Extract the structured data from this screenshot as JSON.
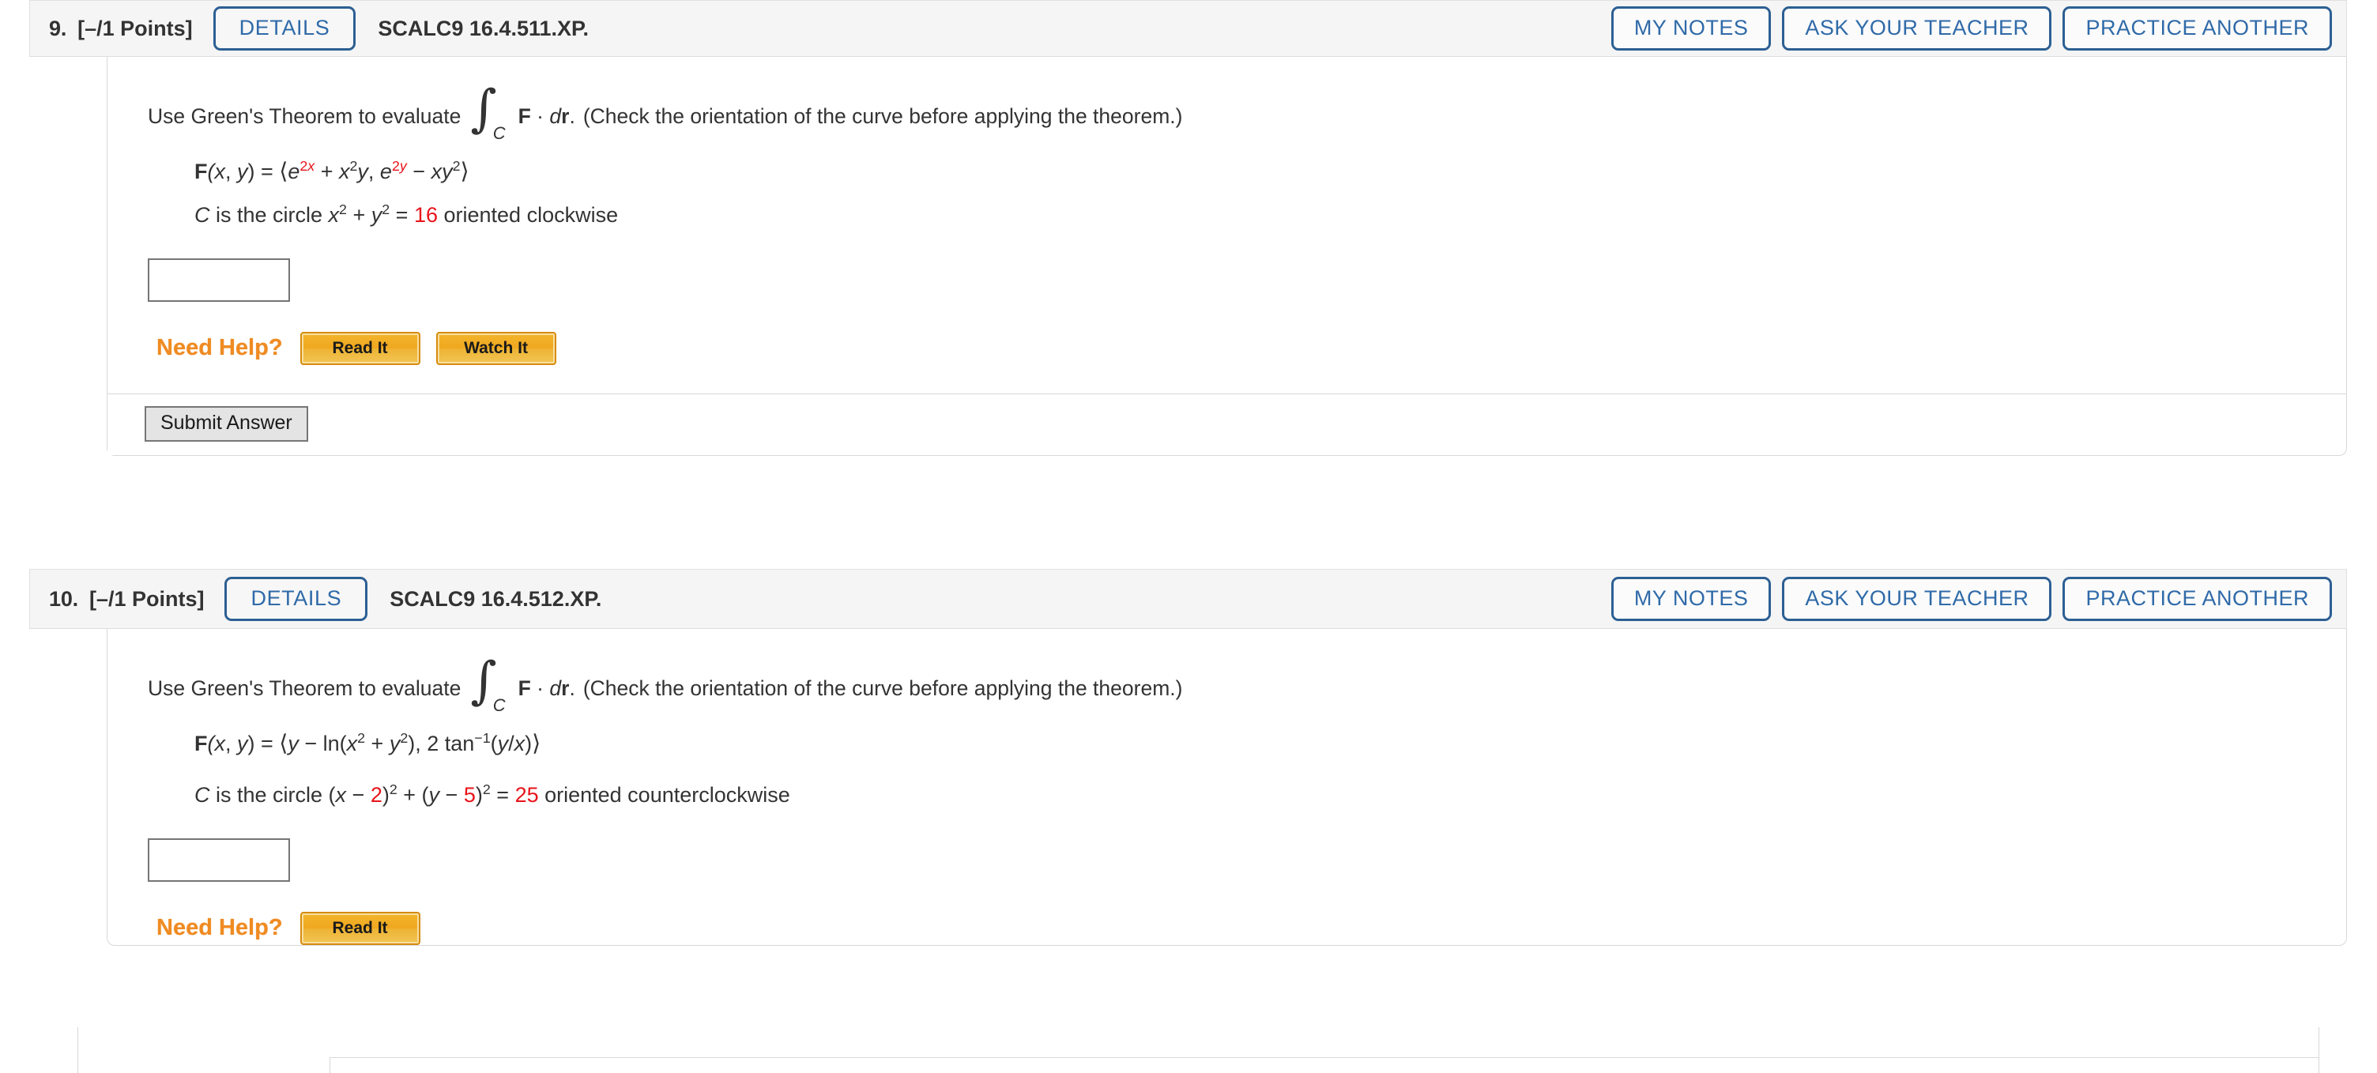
{
  "problems": [
    {
      "number": "9.",
      "points": "[–/1 Points]",
      "details_label": "DETAILS",
      "code": "SCALC9 16.4.511.XP.",
      "my_notes_label": "MY NOTES",
      "ask_teacher_label": "ASK YOUR TEACHER",
      "practice_another_label": "PRACTICE ANOTHER",
      "prompt_before": "Use Green's Theorem to evaluate",
      "integral_subscript": "C",
      "integrand": "F · dr.",
      "prompt_after": "(Check the orientation of the curve before applying the theorem.)",
      "field_line": "F(x, y) = ⟨e2x + x2y, e2y − xy2⟩",
      "curve_line": "C is the circle x2 + y2 = 16 oriented clockwise",
      "field_parts": {
        "lhs": "F",
        "args": "(x, y) = ",
        "open": "⟨",
        "e1_base": "e",
        "e1_exp": "2x",
        "e1_rest_a": " + ",
        "e1_x": "x",
        "e1_x_exp": "2",
        "e1_y": "y",
        "comma": ", ",
        "e2_base": "e",
        "e2_exp": "2y",
        "e2_minus": " − ",
        "e2_xy": "xy",
        "e2_exp2": "2",
        "close": "⟩"
      },
      "curve_parts": {
        "c": "C",
        "is_the_circle": " is the circle ",
        "x": "x",
        "x_exp": "2",
        "plus": " + ",
        "y": "y",
        "y_exp": "2",
        "equals": " = ",
        "radius_sq": "16",
        "orientation": " oriented clockwise"
      },
      "answer_value": "",
      "answer_placeholder": "",
      "need_help_label": "Need Help?",
      "help_buttons": [
        "Read It",
        "Watch It"
      ],
      "submit_label": "Submit Answer",
      "has_submit": true
    },
    {
      "number": "10.",
      "points": "[–/1 Points]",
      "details_label": "DETAILS",
      "code": "SCALC9 16.4.512.XP.",
      "my_notes_label": "MY NOTES",
      "ask_teacher_label": "ASK YOUR TEACHER",
      "practice_another_label": "PRACTICE ANOTHER",
      "prompt_before": "Use Green's Theorem to evaluate",
      "integral_subscript": "C",
      "integrand": "F · dr.",
      "prompt_after": "(Check the orientation of the curve before applying the theorem.)",
      "field_line": "F(x, y) = ⟨y − ln(x2 + y2), 2 tan−1(y/x)⟩",
      "curve_line": "C is the circle (x − 2)2 + (y − 5)2 = 25 oriented counterclockwise",
      "field_parts2": {
        "lhs": "F",
        "args": "(x, y) = ",
        "open": "⟨",
        "y": "y",
        "minus": " − ",
        "ln": "ln(",
        "x": "x",
        "x_exp": "2",
        "plus": " + ",
        "y2": "y",
        "y2_exp": "2",
        "close_paren": "), 2 tan",
        "inv_exp": "−1",
        "tail": "(y/x)",
        "close": "⟩"
      },
      "curve_parts2": {
        "c": "C",
        "is_the_circle": " is the circle (",
        "x": "x",
        "minus1": " − ",
        "h": "2",
        "close1": ")",
        "exp1": "2",
        "plus": " + (",
        "y": "y",
        "minus2": " − ",
        "k": "5",
        "close2": ")",
        "exp2": "2",
        "equals": " = ",
        "radius_sq": "25",
        "orientation": " oriented counterclockwise"
      },
      "answer_value": "",
      "answer_placeholder": "",
      "need_help_label": "Need Help?",
      "help_buttons": [
        "Read It"
      ],
      "submit_label": "",
      "has_submit": false
    }
  ],
  "colors": {
    "accent_blue": "#2f6aa8",
    "border_blue": "#2c5f93",
    "red_value": "#e8131a",
    "need_help_orange": "#ef8b22",
    "help_button_gold": "#f0a81f",
    "header_bg": "#f5f5f5",
    "card_border": "#d8d8d8",
    "text": "#333333"
  }
}
